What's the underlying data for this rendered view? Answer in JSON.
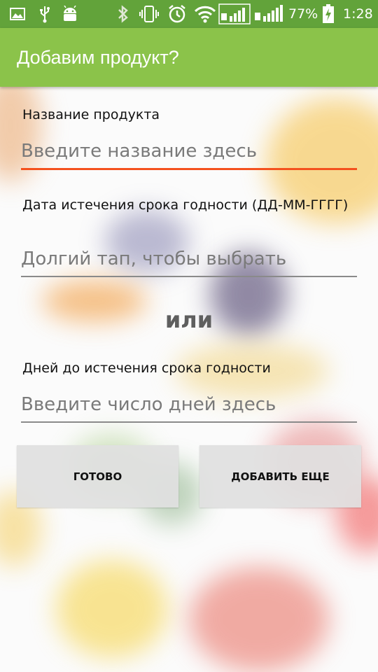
{
  "status_bar": {
    "battery": "77%",
    "time": "1:28",
    "icons": [
      "image-icon",
      "usb-icon",
      "android-icon",
      "bluetooth-icon",
      "vibrate-icon",
      "alarm-icon",
      "wifi-icon",
      "sim1-signal-icon",
      "sim2-signal-icon",
      "battery-charging-icon"
    ]
  },
  "app_bar": {
    "title": "Добавим продукт?"
  },
  "form": {
    "name_label": "Название продукта",
    "name_placeholder": "Введите название здесь",
    "date_label": "Дата истечения срока годности (ДД-ММ-ГГГГ)",
    "date_placeholder": "Долгий тап, чтобы выбрать",
    "or_text": "или",
    "days_label": "Дней до истечения срока годности",
    "days_placeholder": "Введите число дней здесь"
  },
  "buttons": {
    "done": "ГОТОВО",
    "add_more": "ДОБАВИТЬ ЕЩЕ"
  },
  "colors": {
    "status_bar": "#62a33a",
    "app_bar": "#8bc34a",
    "accent": "#f4511e"
  }
}
